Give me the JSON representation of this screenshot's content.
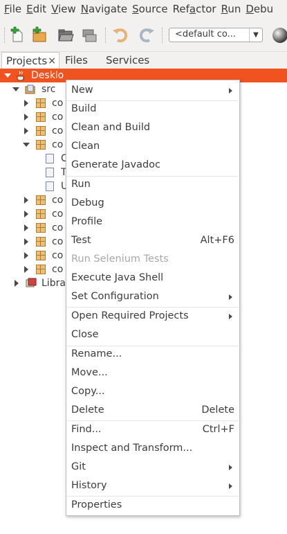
{
  "menubar": {
    "items": [
      {
        "u": "F",
        "rest": "ile"
      },
      {
        "u": "E",
        "rest": "dit"
      },
      {
        "u": "V",
        "rest": "iew"
      },
      {
        "u": "N",
        "rest": "avigate"
      },
      {
        "u": "S",
        "rest": "ource"
      },
      {
        "pre": "Ref",
        "u": "a",
        "rest": "ctor"
      },
      {
        "u": "R",
        "rest": "un"
      },
      {
        "u": "D",
        "rest": "ebu"
      }
    ]
  },
  "toolbar": {
    "config_value": "<default co...",
    "icons": [
      "new-file-icon",
      "new-project-icon",
      "open-project-icon",
      "close-project-icon",
      "undo-icon",
      "redo-icon",
      "run-globe-icon"
    ]
  },
  "tabs": {
    "projects": "Projects",
    "close": "×",
    "files": "Files",
    "services": "Services"
  },
  "tree": {
    "project": "Desklo",
    "src": "src",
    "pkg": "co",
    "files": [
      "C",
      "T",
      "U"
    ],
    "libraries": "Libra"
  },
  "context_menu": {
    "items": [
      {
        "label": "New",
        "submenu": true
      },
      {
        "label": "Build"
      },
      {
        "label": "Clean and Build"
      },
      {
        "label": "Clean"
      },
      {
        "label": "Generate Javadoc"
      },
      {
        "label": "Run"
      },
      {
        "label": "Debug"
      },
      {
        "label": "Profile"
      },
      {
        "label": "Test",
        "accel": "Alt+F6"
      },
      {
        "label": "Run Selenium Tests",
        "disabled": true
      },
      {
        "label": "Execute Java Shell"
      },
      {
        "label": "Set Configuration",
        "submenu": true
      },
      {
        "label": "Open Required Projects",
        "submenu": true
      },
      {
        "label": "Close"
      },
      {
        "label": "Rename..."
      },
      {
        "label": "Move..."
      },
      {
        "label": "Copy..."
      },
      {
        "label": "Delete",
        "accel": "Delete"
      },
      {
        "label": "Find...",
        "accel": "Ctrl+F"
      },
      {
        "label": "Inspect and Transform..."
      },
      {
        "label": "Git",
        "submenu": true
      },
      {
        "label": "History",
        "submenu": true
      },
      {
        "label": "Properties"
      }
    ]
  },
  "colors": {
    "selection": "#f0531f",
    "chrome": "#f2f1f0"
  }
}
